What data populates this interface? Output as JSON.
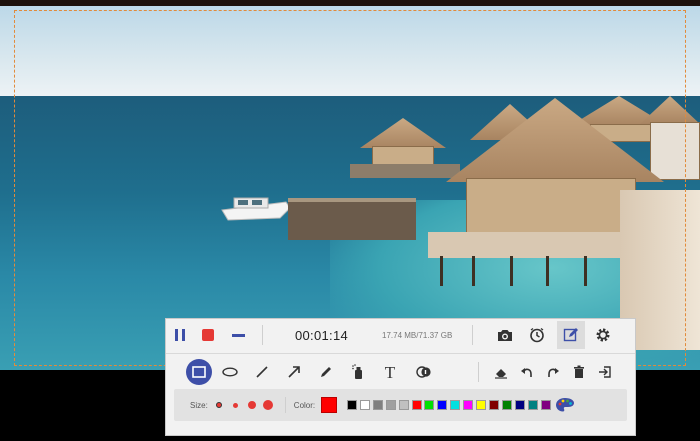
{
  "recorder": {
    "elapsed_time": "00:01:14",
    "file_size": "17.74 MB/71.37 GB",
    "controls": {
      "pause_icon": "pause-icon",
      "stop_icon": "stop-icon",
      "minimize_icon": "minimize-icon",
      "snapshot_icon": "camera-icon",
      "schedule_icon": "clock-icon",
      "edit_icon": "pencil-edit-icon",
      "settings_icon": "gear-icon"
    }
  },
  "annotation_tools": {
    "tools": [
      "rectangle",
      "ellipse",
      "line",
      "arrow",
      "pencil",
      "spray",
      "text",
      "callout"
    ],
    "selected_tool": "rectangle",
    "text_tool_glyph": "T",
    "actions": [
      "eraser",
      "undo",
      "redo",
      "delete",
      "exit"
    ]
  },
  "style_options": {
    "size_label": "Size:",
    "sizes": [
      "xs",
      "s",
      "m",
      "l"
    ],
    "color_label": "Color:",
    "current_color": "#ff0000",
    "palette": [
      "#000000",
      "#ffffff",
      "#808080",
      "#a0a0a0",
      "#c0c0c0",
      "#ff0000",
      "#00e000",
      "#0000ff",
      "#00e0e0",
      "#ff00ff",
      "#ffff00",
      "#800000",
      "#008000",
      "#000080",
      "#008080",
      "#800080"
    ],
    "palette_icon": "palette-icon"
  }
}
